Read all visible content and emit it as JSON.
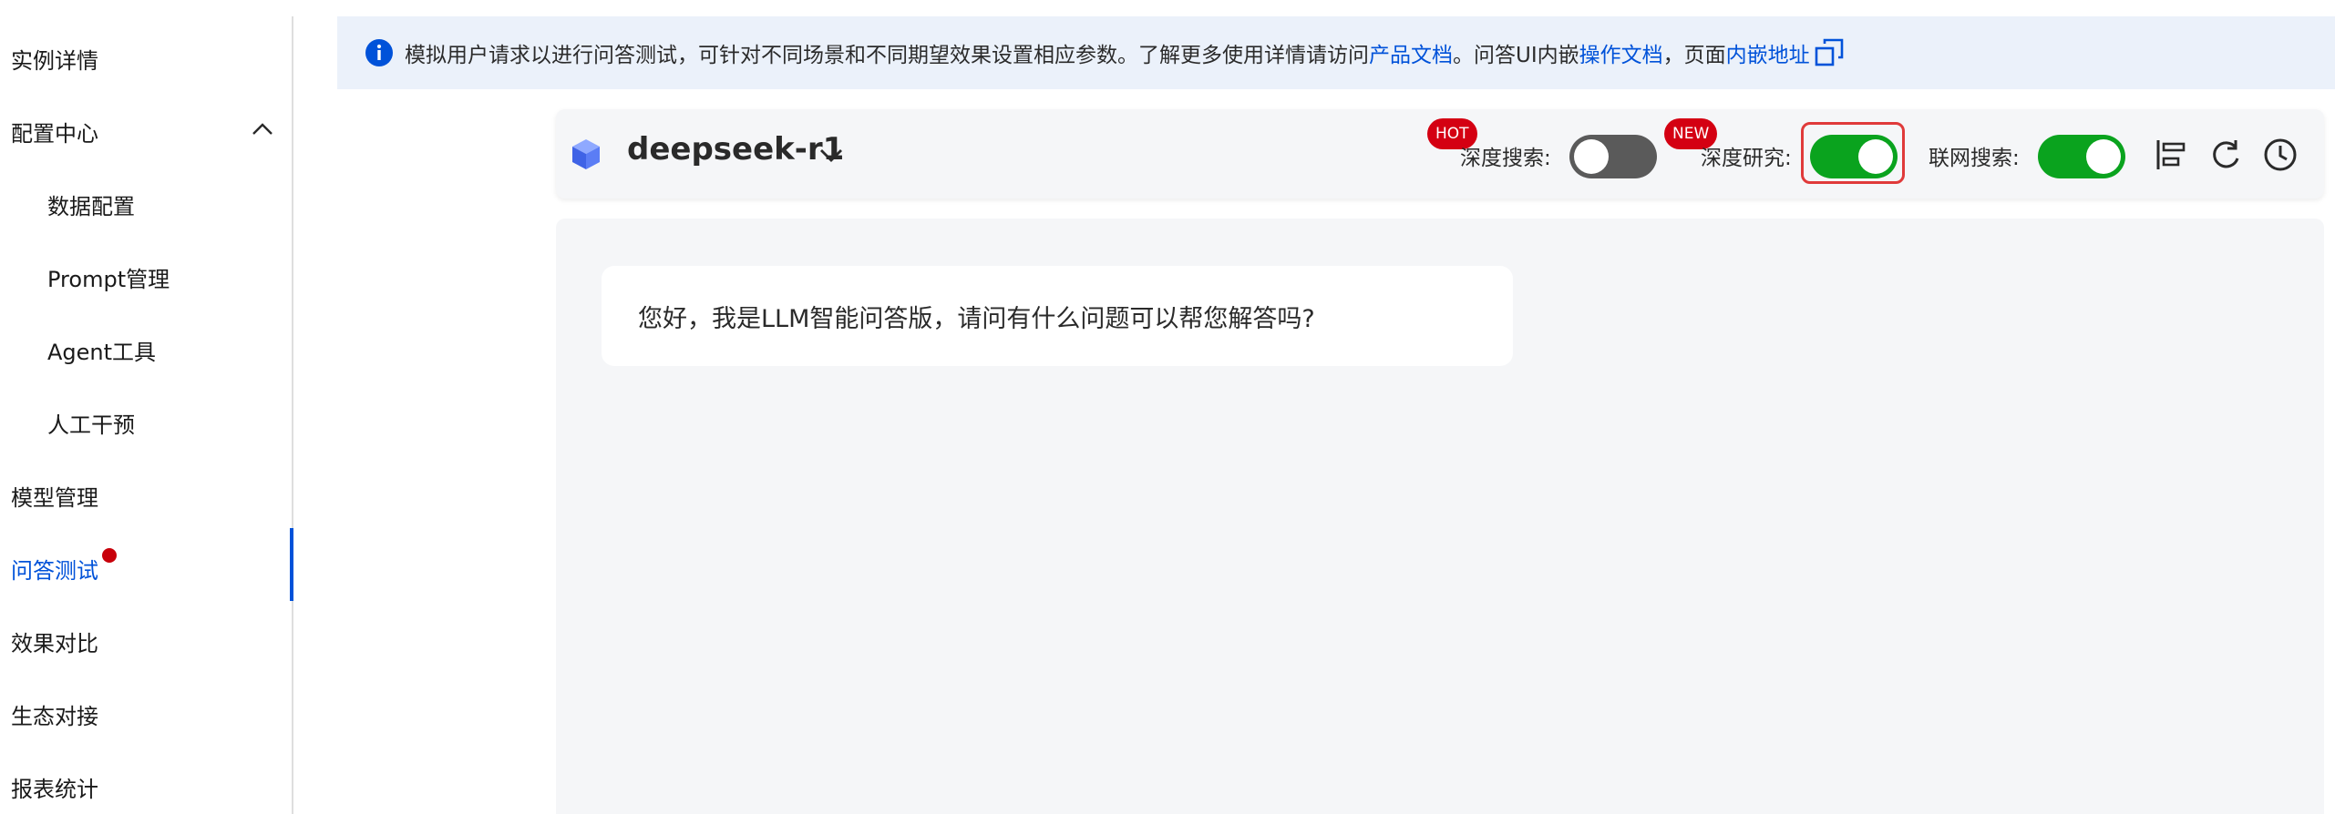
{
  "sidebar": {
    "items": [
      {
        "label": "实例详情"
      },
      {
        "label": "配置中心"
      },
      {
        "label": "数据配置"
      },
      {
        "label": "Prompt管理"
      },
      {
        "label": "Agent工具"
      },
      {
        "label": "人工干预"
      },
      {
        "label": "模型管理"
      },
      {
        "label": "问答测试",
        "active": true,
        "has_notification_dot": true
      },
      {
        "label": "效果对比"
      },
      {
        "label": "生态对接"
      },
      {
        "label": "报表统计"
      }
    ],
    "accent_color": "#0052d9"
  },
  "banner": {
    "text_before": "模拟用户请求以进行问答测试，可针对不同场景和不同期望效果设置相应参数。了解更多使用详情请访问 ",
    "link_product_doc": "产品文档",
    "text_mid": "。问答UI内嵌",
    "link_operation_doc": "操作文档",
    "text_sep": "，页面",
    "link_embed_url": "内嵌地址",
    "icon": "info-icon",
    "background": "#ebf1fa"
  },
  "toolbar": {
    "model_name": "deepseek-r1",
    "model_icon": "cube-icon",
    "deep_search": {
      "label": "深度搜索:",
      "enabled": false,
      "badge": "HOT"
    },
    "deep_research": {
      "label": "深度研究:",
      "enabled": true,
      "badge": "NEW",
      "highlighted": true
    },
    "web_search": {
      "label": "联网搜索:",
      "enabled": true
    },
    "tools": [
      "align-left-icon",
      "refresh-icon",
      "history-clock-icon"
    ],
    "toggle_on_color": "#0aa31e",
    "badge_color": "#d40012"
  },
  "chat": {
    "greeting": "您好，我是LLM智能问答版，请问有什么问题可以帮您解答吗?"
  }
}
